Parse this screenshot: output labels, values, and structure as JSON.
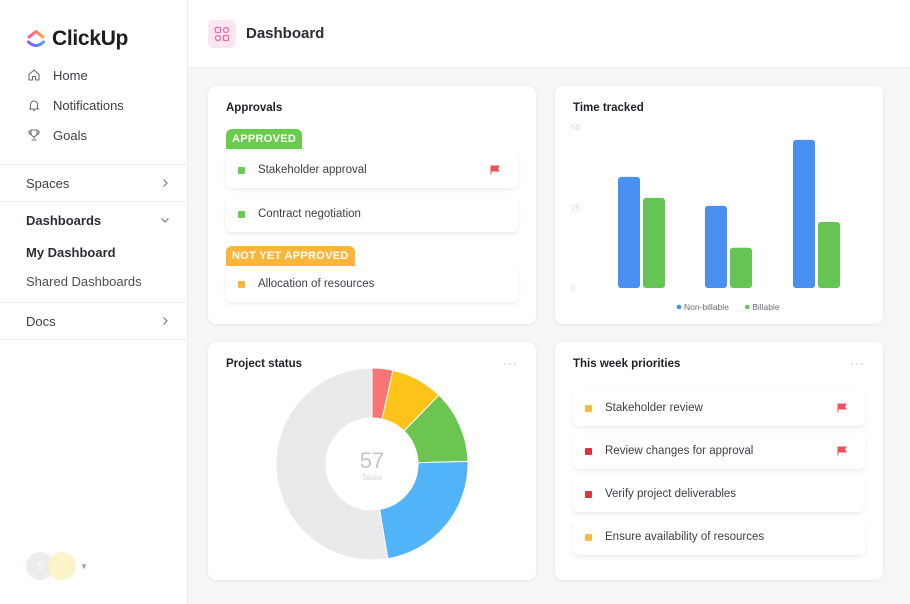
{
  "app": {
    "name": "ClickUp"
  },
  "sidebar": {
    "nav": [
      {
        "label": "Home",
        "icon": "home-icon"
      },
      {
        "label": "Notifications",
        "icon": "bell-icon"
      },
      {
        "label": "Goals",
        "icon": "trophy-icon"
      }
    ],
    "spaces_label": "Spaces",
    "dashboards_label": "Dashboards",
    "dashboard_items": [
      {
        "label": "My Dashboard",
        "active": true
      },
      {
        "label": "Shared Dashboards",
        "active": false
      }
    ],
    "docs_label": "Docs",
    "avatar_initial": "S"
  },
  "header": {
    "title": "Dashboard"
  },
  "approvals": {
    "title": "Approvals",
    "approved_label": "APPROVED",
    "not_approved_label": "NOT YET APPROVED",
    "approved_items": [
      {
        "label": "Stakeholder approval",
        "flag": true
      },
      {
        "label": "Contract negotiation",
        "flag": false
      }
    ],
    "pending_items": [
      {
        "label": "Allocation of resources",
        "flag": false
      }
    ]
  },
  "colors": {
    "green": "#6bcb4f",
    "orange": "#fbb63a",
    "red_flag": "#f0505a",
    "blue": "#4a90f0",
    "priority_red": "#d9363e",
    "brand_pink": "#f06aa8"
  },
  "chart_data": [
    {
      "type": "bar",
      "title": "Time tracked",
      "categories": [
        "",
        "",
        ""
      ],
      "yticks": [
        "50",
        "25",
        "0"
      ],
      "ylim": [
        0,
        50
      ],
      "series": [
        {
          "name": "Non-billable",
          "color": "#4a90f0",
          "values": [
            34.5,
            25.5,
            46
          ]
        },
        {
          "name": "Billable",
          "color": "#65c454",
          "values": [
            28,
            12.5,
            20.5
          ]
        }
      ],
      "legend": "bottom",
      "grid": false
    },
    {
      "type": "pie",
      "title": "Project status",
      "center_value": "57",
      "center_label": "Tasks",
      "slices": [
        {
          "name": "red",
          "color": "#f87575",
          "value": 2
        },
        {
          "name": "yellow",
          "color": "#fcc419",
          "value": 5
        },
        {
          "name": "green",
          "color": "#6cc551",
          "value": 7
        },
        {
          "name": "blue",
          "color": "#51b3f8",
          "value": 13
        },
        {
          "name": "gray",
          "color": "#e9eaec",
          "value": 30
        }
      ]
    }
  ],
  "project_status": {
    "title": "Project status",
    "menu": "···",
    "center_value": "57",
    "center_label": "Tasks"
  },
  "time_tracked": {
    "title": "Time tracked"
  },
  "priorities": {
    "title": "This week priorities",
    "menu": "···",
    "items": [
      {
        "label": "Stakeholder review",
        "color": "#f5b94a",
        "flag": true
      },
      {
        "label": "Review changes for approval",
        "color": "#d9363e",
        "flag": true
      },
      {
        "label": "Verify project deliverables",
        "color": "#d9363e",
        "flag": false
      },
      {
        "label": "Ensure availability of resources",
        "color": "#f5b94a",
        "flag": false
      }
    ]
  }
}
